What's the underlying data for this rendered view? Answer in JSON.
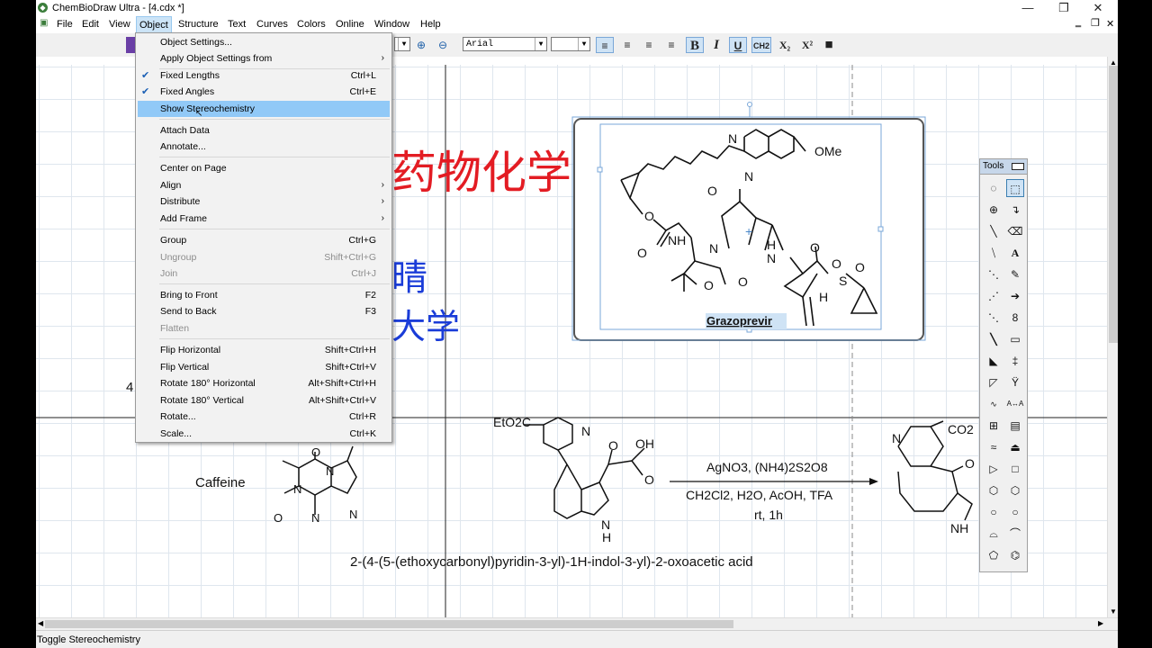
{
  "window": {
    "title": "ChemBioDraw Ultra - [4.cdx *]",
    "app_icon": "chembiodraw-icon"
  },
  "menubar": [
    "File",
    "Edit",
    "View",
    "Object",
    "Structure",
    "Text",
    "Curves",
    "Colors",
    "Online",
    "Window",
    "Help"
  ],
  "active_menu": "Object",
  "toolbar": {
    "font_name": "Arial",
    "font_size": "",
    "bold": "B",
    "italic": "I",
    "underline": "U",
    "formula": "CH2",
    "subscript": "X₂",
    "superscript": "X²"
  },
  "object_menu": {
    "items": [
      {
        "label": "Object Settings...",
        "shortcut": "",
        "checked": false,
        "disabled": false,
        "submenu": false
      },
      {
        "label": "Apply Object Settings from",
        "shortcut": "",
        "checked": false,
        "disabled": false,
        "submenu": true
      },
      {
        "label": "Fixed Lengths",
        "shortcut": "Ctrl+L",
        "checked": true,
        "disabled": false,
        "submenu": false
      },
      {
        "label": "Fixed Angles",
        "shortcut": "Ctrl+E",
        "checked": true,
        "disabled": false,
        "submenu": false
      },
      {
        "label": "Show Stereochemistry",
        "shortcut": "",
        "checked": false,
        "disabled": false,
        "submenu": false
      },
      {
        "label": "Attach Data",
        "shortcut": "",
        "checked": false,
        "disabled": false,
        "submenu": false
      },
      {
        "label": "Annotate...",
        "shortcut": "",
        "checked": false,
        "disabled": false,
        "submenu": false
      },
      {
        "label": "Center on Page",
        "shortcut": "",
        "checked": false,
        "disabled": false,
        "submenu": false
      },
      {
        "label": "Align",
        "shortcut": "",
        "checked": false,
        "disabled": false,
        "submenu": true
      },
      {
        "label": "Distribute",
        "shortcut": "",
        "checked": false,
        "disabled": false,
        "submenu": true
      },
      {
        "label": "Add Frame",
        "shortcut": "",
        "checked": false,
        "disabled": false,
        "submenu": true
      },
      {
        "label": "Group",
        "shortcut": "Ctrl+G",
        "checked": false,
        "disabled": false,
        "submenu": false
      },
      {
        "label": "Ungroup",
        "shortcut": "Shift+Ctrl+G",
        "checked": false,
        "disabled": true,
        "submenu": false
      },
      {
        "label": "Join",
        "shortcut": "Ctrl+J",
        "checked": false,
        "disabled": true,
        "submenu": false
      },
      {
        "label": "Bring to Front",
        "shortcut": "F2",
        "checked": false,
        "disabled": false,
        "submenu": false
      },
      {
        "label": "Send to Back",
        "shortcut": "F3",
        "checked": false,
        "disabled": false,
        "submenu": false
      },
      {
        "label": "Flatten",
        "shortcut": "",
        "checked": false,
        "disabled": true,
        "submenu": false
      },
      {
        "label": "Flip Horizontal",
        "shortcut": "Shift+Ctrl+H",
        "checked": false,
        "disabled": false,
        "submenu": false
      },
      {
        "label": "Flip Vertical",
        "shortcut": "Shift+Ctrl+V",
        "checked": false,
        "disabled": false,
        "submenu": false
      },
      {
        "label": "Rotate 180° Horizontal",
        "shortcut": "Alt+Shift+Ctrl+H",
        "checked": false,
        "disabled": false,
        "submenu": false
      },
      {
        "label": "Rotate 180° Vertical",
        "shortcut": "Alt+Shift+Ctrl+V",
        "checked": false,
        "disabled": false,
        "submenu": false
      },
      {
        "label": "Rotate...",
        "shortcut": "Ctrl+R",
        "checked": false,
        "disabled": false,
        "submenu": false
      },
      {
        "label": "Scale...",
        "shortcut": "Ctrl+K",
        "checked": false,
        "disabled": false,
        "submenu": false
      }
    ],
    "highlighted": "Show Stereochemistry"
  },
  "canvas": {
    "heading_red": "药物化学",
    "text_blue_1": "晴",
    "text_blue_2": "大学",
    "stray_text": "4",
    "grazoprevir": {
      "caption": "Grazoprevir",
      "labels": [
        "N",
        "N",
        "OMe",
        "O",
        "O",
        "NH",
        "N",
        "H",
        "N",
        "H",
        "O",
        "O",
        "O",
        "O",
        "S",
        "O",
        "O",
        "+"
      ]
    },
    "caffeine": {
      "caption": "Caffeine",
      "labels": [
        "O",
        "N",
        "N",
        "O",
        "N",
        "N"
      ]
    },
    "reaction": {
      "reactant_labels": [
        "EtO2C",
        "N",
        "OH",
        "O",
        "O",
        "N",
        "H"
      ],
      "reagents_above": "AgNO3, (NH4)2S2O8",
      "reagents_below": "CH2Cl2, H2O, AcOH, TFA",
      "conditions": "rt, 1h",
      "product_labels": [
        "N",
        "CO2",
        "O",
        "NH"
      ],
      "reactant_name": "2-(4-(5-(ethoxycarbonyl)pyridin-3-yl)-1H-indol-3-yl)-2-oxoacetic acid"
    }
  },
  "tools_palette": {
    "title": "Tools",
    "text_tool": "A"
  },
  "status": "Toggle Stereochemistry"
}
